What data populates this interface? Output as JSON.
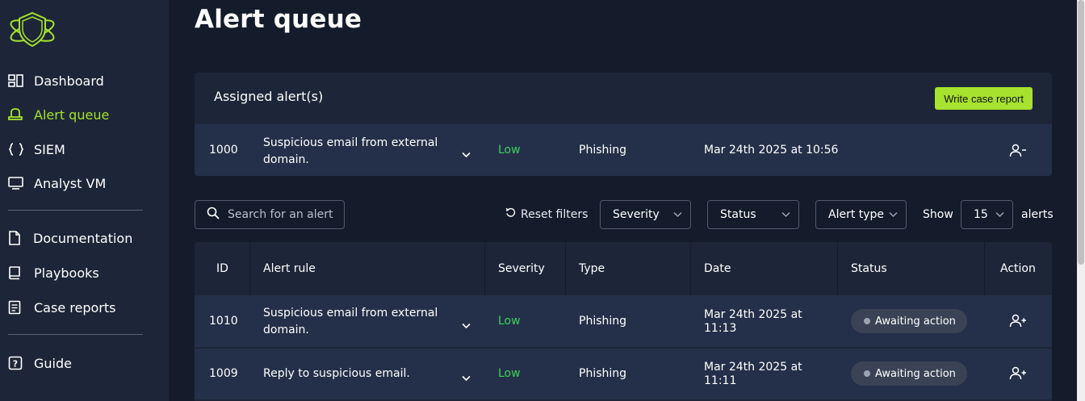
{
  "sidebar": {
    "items": [
      {
        "label": "Dashboard",
        "icon": "dashboard-icon"
      },
      {
        "label": "Alert queue",
        "icon": "alert-queue-icon",
        "active": true
      },
      {
        "label": "SIEM",
        "icon": "braces-icon"
      },
      {
        "label": "Analyst VM",
        "icon": "monitor-icon"
      },
      {
        "label": "Documentation",
        "icon": "document-icon"
      },
      {
        "label": "Playbooks",
        "icon": "book-icon"
      },
      {
        "label": "Case reports",
        "icon": "report-icon"
      },
      {
        "label": "Guide",
        "icon": "help-icon"
      }
    ],
    "accent": "#a6e22e"
  },
  "page": {
    "title": "Alert queue"
  },
  "assigned": {
    "title": "Assigned alert(s)",
    "write_report_label": "Write case report",
    "row": {
      "id": "1000",
      "rule_line1": "Suspicious email from external",
      "rule_line2": "domain.",
      "severity": "Low",
      "type": "Phishing",
      "date": "Mar 24th 2025 at 10:56",
      "action_icon": "unassign-user-icon"
    }
  },
  "filters": {
    "search_placeholder": "Search for an alert",
    "reset_label": "Reset filters",
    "severity_label": "Severity",
    "status_label": "Status",
    "alert_type_label": "Alert type",
    "show_label": "Show",
    "page_size": "15",
    "alerts_label": "alerts"
  },
  "table": {
    "headers": {
      "id": "ID",
      "rule": "Alert rule",
      "severity": "Severity",
      "type": "Type",
      "date": "Date",
      "status": "Status",
      "action": "Action"
    },
    "rows": [
      {
        "id": "1010",
        "rule_line1": "Suspicious email from external",
        "rule_line2": "domain.",
        "severity": "Low",
        "type": "Phishing",
        "date_line1": "Mar 24th 2025 at",
        "date_line2": "11:13",
        "status": "Awaiting action",
        "action_icon": "assign-user-icon"
      },
      {
        "id": "1009",
        "rule_line1": "Reply to suspicious email.",
        "rule_line2": "",
        "severity": "Low",
        "type": "Phishing",
        "date_line1": "Mar 24th 2025 at",
        "date_line2": "11:11",
        "status": "Awaiting action",
        "action_icon": "assign-user-icon"
      }
    ]
  },
  "colors": {
    "background": "#141c2c",
    "panel": "#1d2638",
    "row": "#243049",
    "severity_low": "#3fcf5a"
  }
}
